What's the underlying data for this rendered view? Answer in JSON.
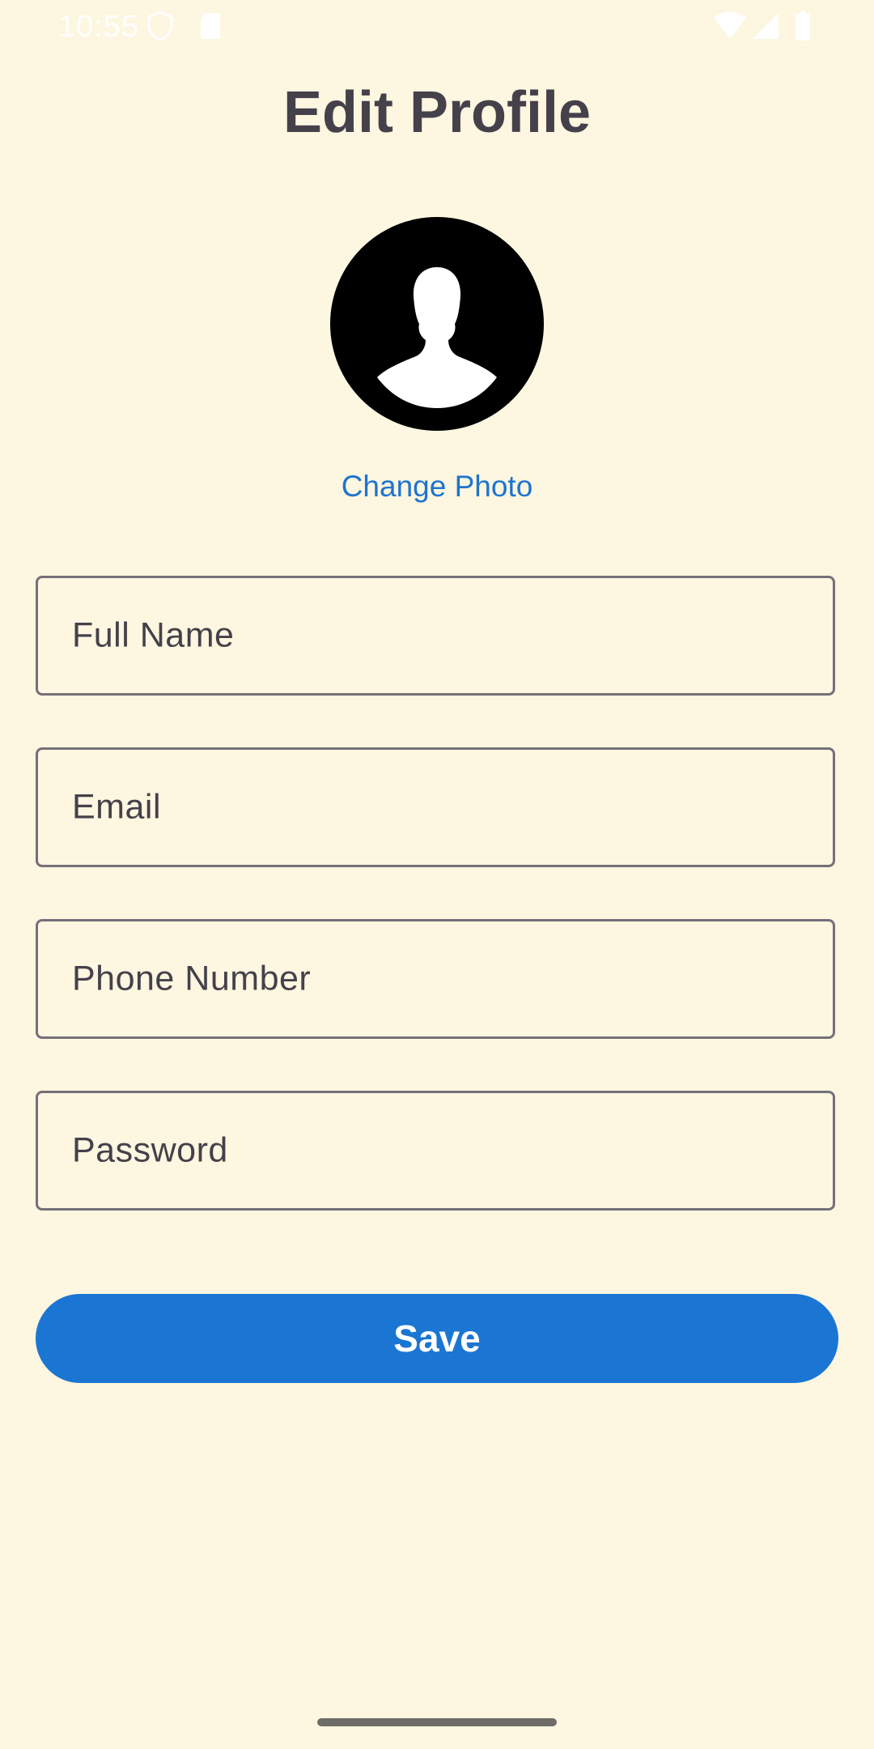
{
  "status_bar": {
    "time": "10:55",
    "icons": [
      "shield-icon",
      "sd-card-icon",
      "wifi-icon",
      "signal-icon",
      "battery-icon"
    ]
  },
  "page": {
    "title": "Edit Profile",
    "avatar_icon": "person-silhouette-icon",
    "change_photo_label": "Change Photo"
  },
  "form": {
    "fields": [
      {
        "label": "Full Name"
      },
      {
        "label": "Email"
      },
      {
        "label": "Phone Number"
      },
      {
        "label": "Password"
      }
    ],
    "save_label": "Save"
  },
  "colors": {
    "background": "#FDF6E0",
    "accent": "#1B76D3",
    "link": "#1E74CF",
    "text": "#45414B",
    "field_border": "#75717A"
  }
}
